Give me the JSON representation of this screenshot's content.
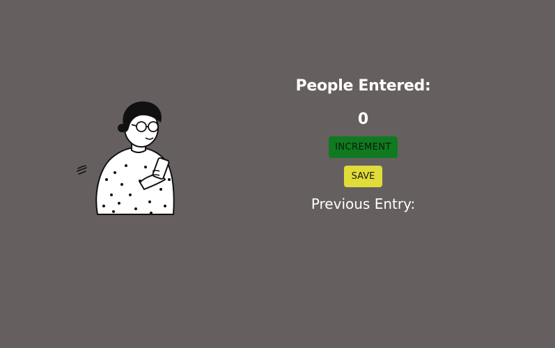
{
  "counter": {
    "title": "People Entered:",
    "count": "0",
    "increment_label": "INCREMENT",
    "save_label": "SAVE",
    "previous_label": "Previous Entry:"
  },
  "colors": {
    "background": "#65605f",
    "increment_button": "#0f7a1f",
    "save_button": "#e0dc3a",
    "text": "#ffffff"
  },
  "icons": {
    "illustration": "person-with-phone-illustration"
  }
}
